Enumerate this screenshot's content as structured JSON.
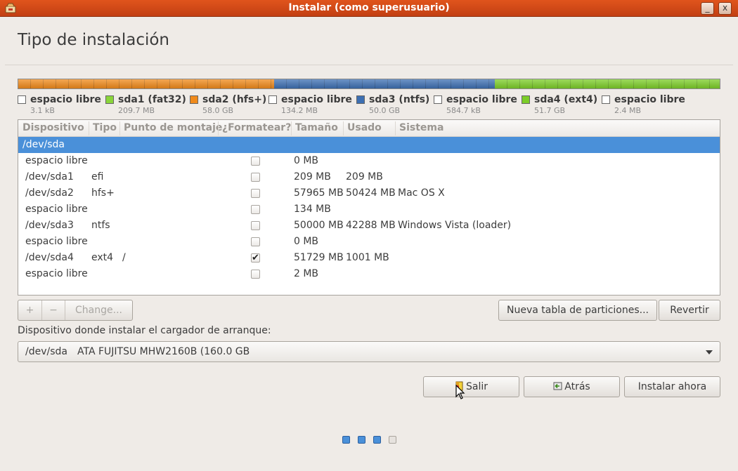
{
  "window": {
    "title": "Instalar (como superusuario)",
    "minimize_glyph": "_",
    "close_glyph": "x"
  },
  "page_title": "Tipo de instalación",
  "colors": {
    "free": "#ffffff",
    "fat32": "#8ad53a",
    "hfs": "#f08a1b",
    "ntfs": "#3d6fb2",
    "ext4": "#7ccd28",
    "accent": "#4a90d9",
    "titlebar": "#d4501a"
  },
  "partition_bar": [
    {
      "name": "espacio libre",
      "size": "3.1 kB",
      "share": 0.0,
      "color": "#ffffff"
    },
    {
      "name": "sda1 (fat32)",
      "size": "209.7 MB",
      "share": 0.0013,
      "color": "#8ad53a"
    },
    {
      "name": "sda2 (hfs+)",
      "size": "58.0 GB",
      "share": 0.3623,
      "color": "#f08a1b"
    },
    {
      "name": "espacio libre",
      "size": "134.2 MB",
      "share": 0.0008,
      "color": "#ffffff"
    },
    {
      "name": "sda3 (ntfs)",
      "size": "50.0 GB",
      "share": 0.3125,
      "color": "#3d6fb2"
    },
    {
      "name": "espacio libre",
      "size": "584.7 kB",
      "share": 0.0,
      "color": "#ffffff"
    },
    {
      "name": "sda4 (ext4)",
      "size": "51.7 GB",
      "share": 0.3231,
      "color": "#7ccd28"
    },
    {
      "name": "espacio libre",
      "size": "2.4 MB",
      "share": 0.0,
      "color": "#ffffff"
    }
  ],
  "table": {
    "columns": [
      "Dispositivo",
      "Tipo",
      "Punto de montaje",
      "¿Formatear?",
      "Tamaño",
      "Usado",
      "Sistema"
    ],
    "selected_device": "/dev/sda",
    "rows": [
      {
        "device": "espacio libre",
        "type": "",
        "mount": "",
        "format": false,
        "size": "0 MB",
        "used": "",
        "system": ""
      },
      {
        "device": "/dev/sda1",
        "type": "efi",
        "mount": "",
        "format": false,
        "size": "209 MB",
        "used": "209 MB",
        "system": ""
      },
      {
        "device": "/dev/sda2",
        "type": "hfs+",
        "mount": "",
        "format": false,
        "size": "57965 MB",
        "used": "50424 MB",
        "system": "Mac OS X"
      },
      {
        "device": "espacio libre",
        "type": "",
        "mount": "",
        "format": false,
        "size": "134 MB",
        "used": "",
        "system": ""
      },
      {
        "device": "/dev/sda3",
        "type": "ntfs",
        "mount": "",
        "format": false,
        "size": "50000 MB",
        "used": "42288 MB",
        "system": "Windows Vista (loader)"
      },
      {
        "device": "espacio libre",
        "type": "",
        "mount": "",
        "format": false,
        "size": "0 MB",
        "used": "",
        "system": ""
      },
      {
        "device": "/dev/sda4",
        "type": "ext4",
        "mount": "/",
        "format": true,
        "size": "51729 MB",
        "used": "1001 MB",
        "system": ""
      },
      {
        "device": "espacio libre",
        "type": "",
        "mount": "",
        "format": false,
        "size": "2 MB",
        "used": "",
        "system": ""
      }
    ]
  },
  "toolbar": {
    "add_label": "+",
    "remove_label": "−",
    "change_label": "Change...",
    "new_table_label": "Nueva tabla de particiones...",
    "revert_label": "Revertir"
  },
  "bootloader": {
    "label": "Dispositivo donde instalar el cargador de arranque:",
    "device": "/dev/sda",
    "description": "ATA FUJITSU MHW2160B (160.0 GB"
  },
  "actions": {
    "quit_label": "Salir",
    "back_label": "Atrás",
    "install_label": "Instalar ahora"
  },
  "progress": {
    "total_steps": 4,
    "completed_steps": 3
  }
}
